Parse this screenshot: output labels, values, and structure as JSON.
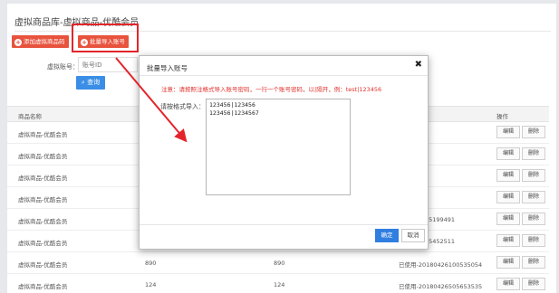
{
  "page": {
    "title": "虚拟商品库-虚拟商品-优酷会员",
    "add_button": "添加虚拟商品码",
    "import_button": "批量导入账号"
  },
  "filter": {
    "account_label": "虚拟账号：",
    "account_placeholder": "账号ID",
    "query_button": "查询",
    "query_icon": "search-icon"
  },
  "table": {
    "headers": {
      "name": "商品名称",
      "actions": "操作"
    },
    "edit_label": "编辑",
    "delete_label": "删除",
    "rows": [
      {
        "name": "虚拟商品-优酷会员",
        "c2": "",
        "c3": "",
        "status": ""
      },
      {
        "name": "虚拟商品-优酷会员",
        "c2": "",
        "c3": "",
        "status": ""
      },
      {
        "name": "虚拟商品-优酷会员",
        "c2": "",
        "c3": "",
        "status": ""
      },
      {
        "name": "虚拟商品-优酷会员",
        "c2": "",
        "c3": "",
        "status": ""
      },
      {
        "name": "虚拟商品-优酷会员",
        "c2": "",
        "c3": "",
        "status": "180428975199491"
      },
      {
        "name": "虚拟商品-优酷会员",
        "c2": "",
        "c3": "",
        "status": "180428565452511"
      },
      {
        "name": "虚拟商品-优酷会员",
        "c2": "890",
        "c3": "890",
        "status": "已使用-20180426100535054"
      },
      {
        "name": "虚拟商品-优酷会员",
        "c2": "124",
        "c3": "124",
        "status": "已使用-20180426505653535"
      }
    ]
  },
  "modal": {
    "title": "批量导入账号",
    "close_icon": "close-icon",
    "notice": "注意：请按照注格式导入账号密码，一行一个账号密码，以|隔开，例：test|123456",
    "field_label": "请按格式导入：",
    "textarea_value": "123456|123456\n123456|1234567",
    "confirm": "确定",
    "cancel": "取消"
  },
  "colors": {
    "accent_orange": "#e8533e",
    "highlight_red": "#e3242b",
    "primary_blue": "#2f7ee0"
  }
}
